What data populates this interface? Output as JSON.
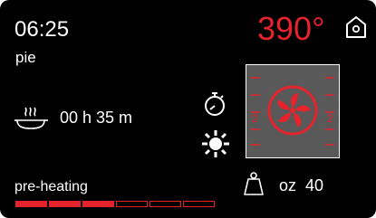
{
  "clock": "06:25",
  "program": "pie",
  "temperature": "390°",
  "cooking": {
    "duration": "00 h 35 m"
  },
  "weight": {
    "unit": "oz",
    "value": "40"
  },
  "fan_panel": {
    "left_level": "2",
    "right_level": "2"
  },
  "status": "pre-heating",
  "preheat_progress": {
    "filled_segments": 3,
    "total_segments": 6
  },
  "colors": {
    "accent": "#e4232d",
    "background": "#000000",
    "panel": "#595959",
    "text": "#ffffff"
  },
  "icons": [
    "home-icon",
    "cooking-dish-icon",
    "timer-icon",
    "oven-light-icon",
    "fan-icon",
    "weight-icon"
  ]
}
